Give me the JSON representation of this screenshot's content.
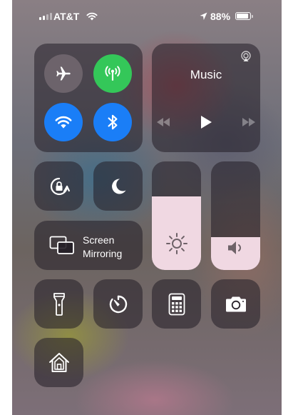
{
  "status_bar": {
    "carrier": "AT&T",
    "battery_percent": "88%",
    "battery_level": 0.88,
    "signal_bars": 2,
    "signal_bars_total": 4
  },
  "connectivity": {
    "airplane_mode": false,
    "cellular_data": true,
    "wifi": true,
    "bluetooth": true
  },
  "music": {
    "title": "Music"
  },
  "toggles": {
    "orientation_lock": false,
    "do_not_disturb": false
  },
  "screen_mirroring": {
    "label_line1": "Screen",
    "label_line2": "Mirroring"
  },
  "brightness": {
    "level": 0.68
  },
  "volume": {
    "level": 0.3
  },
  "colors": {
    "cellular_green": "#34c759",
    "active_blue": "#1a7ef7",
    "slider_fill": "#f0d8e2"
  },
  "shortcuts": [
    "flashlight-icon",
    "timer-icon",
    "calculator-icon",
    "camera-icon",
    "home-icon"
  ]
}
